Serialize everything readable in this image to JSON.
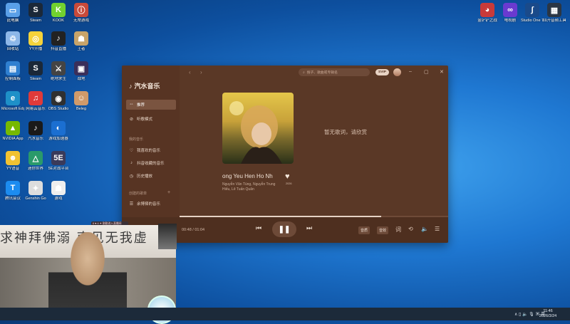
{
  "desktop": {
    "left_icons": [
      {
        "label": "此电脑",
        "color": "#5aa0e8",
        "glyph": "▭"
      },
      {
        "label": "Steam",
        "color": "#1b2838",
        "glyph": "S"
      },
      {
        "label": "KOOK",
        "color": "#72d12f",
        "glyph": "K"
      },
      {
        "label": "无常游戏",
        "color": "#c84a3a",
        "glyph": "ⓘ"
      },
      {
        "label": "回收站",
        "color": "#8db7e8",
        "glyph": "♲"
      },
      {
        "label": "YY开播",
        "color": "#f6d33a",
        "glyph": "◎"
      },
      {
        "label": "抖音直播",
        "color": "#222",
        "glyph": "♪"
      },
      {
        "label": "王者",
        "color": "#c8a46a",
        "glyph": "☗"
      },
      {
        "label": "控制面板",
        "color": "#2f7fd0",
        "glyph": "▤"
      },
      {
        "label": "Steam",
        "color": "#1b2838",
        "glyph": "S"
      },
      {
        "label": "绝地求生",
        "color": "#444",
        "glyph": "⚔"
      },
      {
        "label": "战地",
        "color": "#3a2f5a",
        "glyph": "▣"
      },
      {
        "label": "Microsoft Edge",
        "color": "#1e90c8",
        "glyph": "e"
      },
      {
        "label": "网易云音乐",
        "color": "#e03a3a",
        "glyph": "♫"
      },
      {
        "label": "OBS Studio",
        "color": "#303030",
        "glyph": "◉"
      },
      {
        "label": "Beleg",
        "color": "#d09a6a",
        "glyph": "☺"
      },
      {
        "label": "NVIDIA App",
        "color": "#76b900",
        "glyph": "▲"
      },
      {
        "label": "汽水音乐",
        "color": "#1a1a1a",
        "glyph": "♪"
      },
      {
        "label": "游戏加速器",
        "color": "#1b6fd1",
        "glyph": "◐"
      },
      {
        "label": "YY语音",
        "color": "#f1c232",
        "glyph": "☻"
      },
      {
        "label": "迷你世界",
        "color": "#2a9a6a",
        "glyph": "△"
      },
      {
        "label": "5E对战平台",
        "color": "#3a3a5a",
        "glyph": "5E"
      },
      {
        "label": "腾讯会议",
        "color": "#1c8cf0",
        "glyph": "T"
      },
      {
        "label": "Genshin Go",
        "color": "#ddd",
        "glyph": "✦"
      },
      {
        "label": "游戏",
        "color": "#eee",
        "glyph": "☗"
      }
    ],
    "right_icons": [
      {
        "label": "金铲铲之战",
        "color": "#c83a3a",
        "glyph": "◕"
      },
      {
        "label": "电视剧",
        "color": "#6a3ad0",
        "glyph": "∞"
      },
      {
        "label": "Studio One 7",
        "color": "#1a4a8a",
        "glyph": "∫"
      },
      {
        "label": "四开音频工具箱",
        "color": "#2b3644",
        "glyph": "▦"
      }
    ]
  },
  "player": {
    "app_name": "汽水音乐",
    "nav": [
      {
        "label": "推荐",
        "icon": "◦◦",
        "active": true
      },
      {
        "label": "听歌模式",
        "icon": "⊘",
        "active": false
      }
    ],
    "my_music_title": "我的音乐",
    "my_music": [
      {
        "label": "我喜欢的音乐",
        "icon": "♡"
      },
      {
        "label": "抖音收藏的音乐",
        "icon": "♪"
      },
      {
        "label": "历史播放",
        "icon": "◷"
      }
    ],
    "created_title": "创建的歌单",
    "playlists": [
      {
        "label": "余博择的音乐",
        "icon": "☰"
      }
    ],
    "search_placeholder": "搜子、歌曲或专辑名",
    "svip_label": "SVIP",
    "song_title": "ong Yeu    Hen Ho Nh",
    "artists": "Nguyễn Văn Tùng, Nguyễn Trung Hiếu, Lê Tuấn Quân",
    "like_count": "2026",
    "no_lyrics": "暂无歌词，请欣赏",
    "time": "00:48 / 01:04",
    "progress": 0.75,
    "btn_toggle_1": "音质",
    "btn_toggle_2": "音效",
    "accent": "#5a3826"
  },
  "stream": {
    "banner_text": "求神拜佛溺 南见无我虚",
    "chat_text": "6 ♥ 4 ✦ 刚刚进入直播间"
  },
  "taskbar": {
    "tray_icons": "∧ ▯ 🔈 🎙 ▣ 英",
    "time": "11:46",
    "date": "2026/3/24"
  }
}
